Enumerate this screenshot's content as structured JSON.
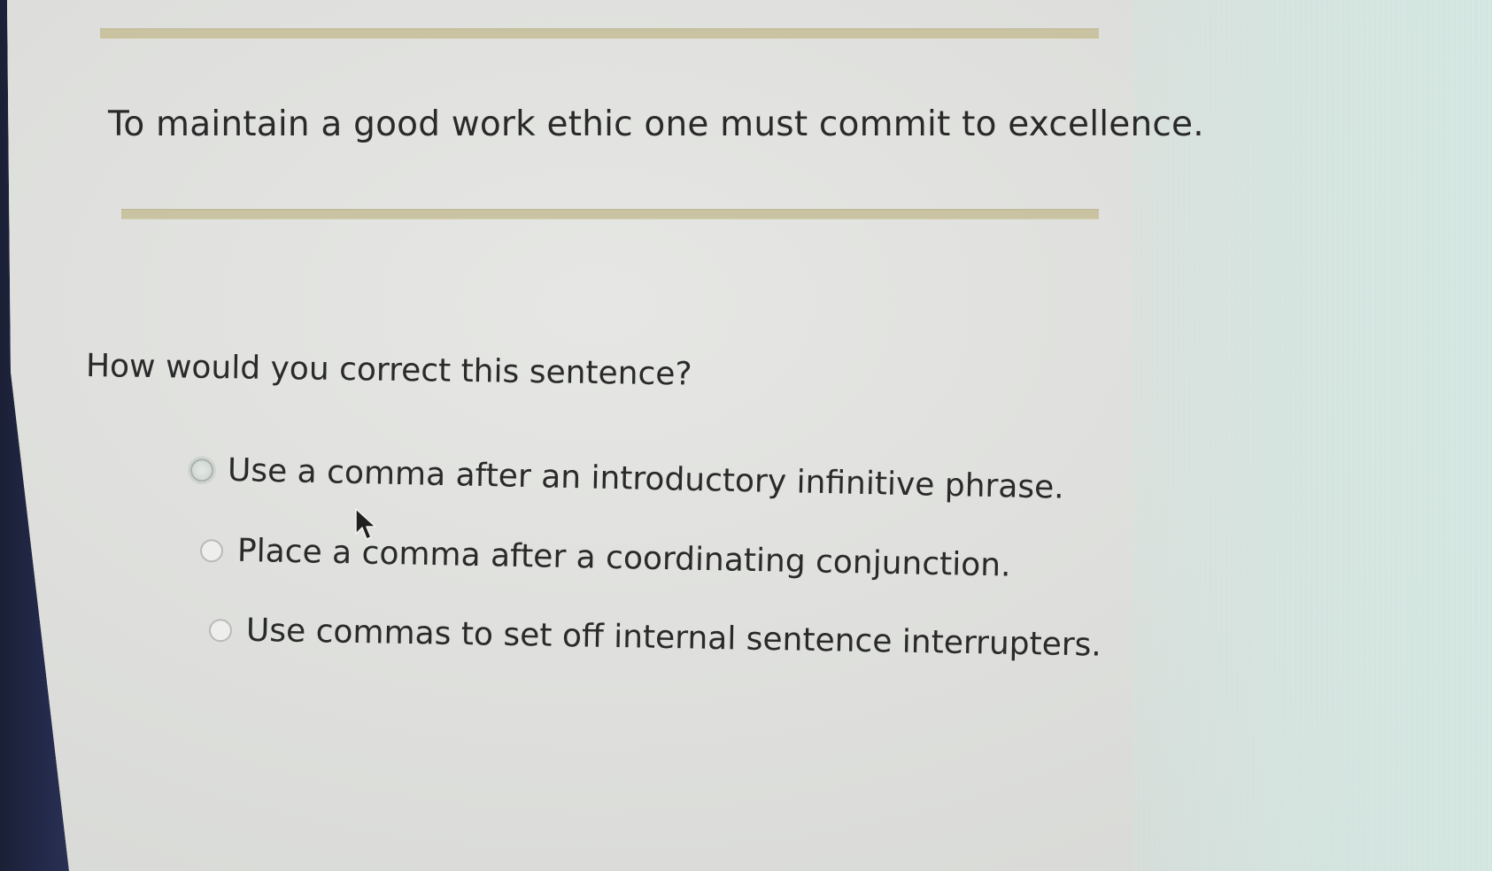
{
  "item": {
    "sentence": "To maintain a good work ethic one must commit to excellence.",
    "question": "How would you correct this sentence?",
    "options": [
      {
        "label": "Use a comma after an introductory infinitive phrase.",
        "selected": false
      },
      {
        "label": "Place a comma after a coordinating conjunction.",
        "selected": false
      },
      {
        "label": "Use commas to set off internal sentence interrupters.",
        "selected": false
      }
    ]
  },
  "icons": {
    "cursor": "arrow-cursor-icon",
    "radio": "radio-button-icon"
  },
  "colors": {
    "background": "#dfe0dd",
    "rule": "#c9c3a2",
    "text": "#2a2a2a"
  }
}
